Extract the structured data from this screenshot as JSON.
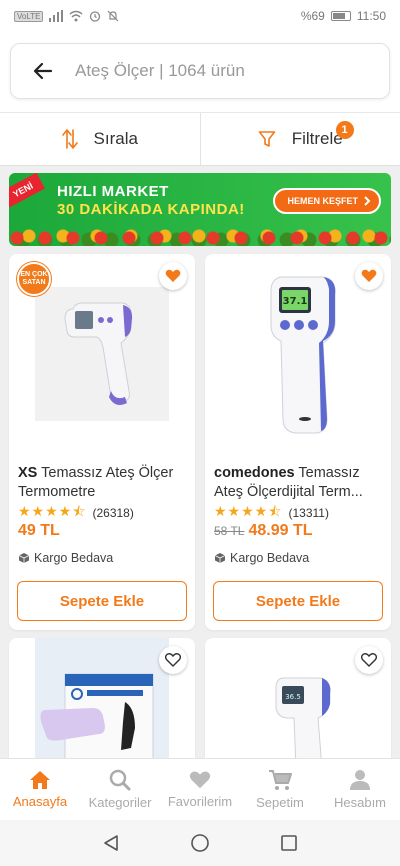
{
  "status": {
    "network_badge": "VoLTE",
    "battery": "%69",
    "time": "11:50"
  },
  "search": {
    "text": "Ateş Ölçer | 1064 ürün"
  },
  "sortbar": {
    "sort_label": "Sırala",
    "filter_label": "Filtrele",
    "filter_count": "1"
  },
  "banner": {
    "ribbon": "YENİ",
    "line1": "HIZLI MARKET",
    "line2": "30 DAKİKADA KAPINDA!",
    "cta": "HEMEN KEŞFET"
  },
  "products": [
    {
      "brand": "XS",
      "name": "Temassız Ateş Ölçer Termometre",
      "rating_count": "(26318)",
      "price": "49 TL",
      "old_price": "",
      "cargo": "Kargo Bedava",
      "button": "Sepete Ekle",
      "ribbon": "EN ÇOK SATAN",
      "favorited": true,
      "stars": 4.5
    },
    {
      "brand": "comedones",
      "name": "Temassız Ateş Ölçerdijital Term...",
      "rating_count": "(13311)",
      "price": "48.99 TL",
      "old_price": "58 TL",
      "cargo": "Kargo Bedava",
      "button": "Sepete Ekle",
      "ribbon": "",
      "favorited": true,
      "stars": 4.5
    }
  ],
  "nav": [
    {
      "label": "Anasayfa",
      "icon": "home-icon",
      "active": true
    },
    {
      "label": "Kategoriler",
      "icon": "search-icon",
      "active": false
    },
    {
      "label": "Favorilerim",
      "icon": "heart-icon",
      "active": false
    },
    {
      "label": "Sepetim",
      "icon": "cart-icon",
      "active": false
    },
    {
      "label": "Hesabım",
      "icon": "user-icon",
      "active": false
    }
  ],
  "colors": {
    "accent": "#f27a1a",
    "banner_green": "#1ca83a",
    "star": "#f7a61a"
  }
}
